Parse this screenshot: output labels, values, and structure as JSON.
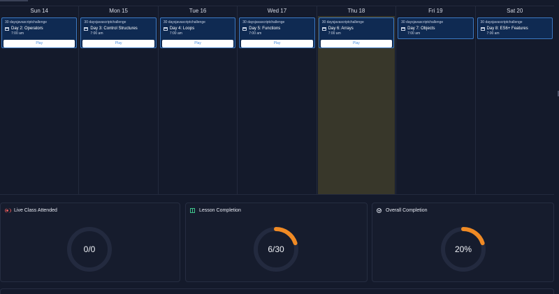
{
  "calendar": {
    "days": [
      {
        "label": "Sun 14",
        "today": false,
        "event": {
          "hashtag": "30 daysjavascriptchallenge",
          "title": "Day 2: Operators",
          "time": "7:00 am",
          "action": "Play"
        }
      },
      {
        "label": "Mon 15",
        "today": false,
        "event": {
          "hashtag": "30 daysjavascriptchallenge",
          "title": "Day 3: Control Structures",
          "time": "7:00 am",
          "action": "Play"
        }
      },
      {
        "label": "Tue 16",
        "today": false,
        "event": {
          "hashtag": "30 daysjavascriptchallenge",
          "title": "Day 4: Loops",
          "time": "7:00 am",
          "action": "Play"
        }
      },
      {
        "label": "Wed 17",
        "today": false,
        "event": {
          "hashtag": "30 daysjavascriptchallenge",
          "title": "Day 5: Functions",
          "time": "7:00 am",
          "action": "Play"
        }
      },
      {
        "label": "Thu 18",
        "today": true,
        "event": {
          "hashtag": "30 daysjavascriptchallenge",
          "title": "Day 6: Arrays",
          "time": "7:00 am",
          "action": "Play"
        }
      },
      {
        "label": "Fri 19",
        "today": false,
        "event": {
          "hashtag": "30 daysjavascriptchallenge",
          "title": "Day 7: Objects",
          "time": "7:00 am",
          "action": ""
        }
      },
      {
        "label": "Sat 20",
        "today": false,
        "event": {
          "hashtag": "30 daysjavascriptchallenge",
          "title": "Day 8: ES6+ Features",
          "time": "7:00 am",
          "action": ""
        }
      }
    ]
  },
  "stats": [
    {
      "title": "Live Class Attended",
      "icon": "live-icon",
      "value_label": "0/0",
      "progress": 0
    },
    {
      "title": "Lesson Completion",
      "icon": "book-icon",
      "value_label": "6/30",
      "progress": 0.2
    },
    {
      "title": "Overall Completion",
      "icon": "check-circle-icon",
      "value_label": "20%",
      "progress": 0.2
    }
  ],
  "colors": {
    "background": "#141a2b",
    "event_bg": "#0f2a52",
    "event_border": "#3c79c2",
    "today_column": "#38372a",
    "progress": "#f08a24",
    "track": "#232a3f"
  }
}
